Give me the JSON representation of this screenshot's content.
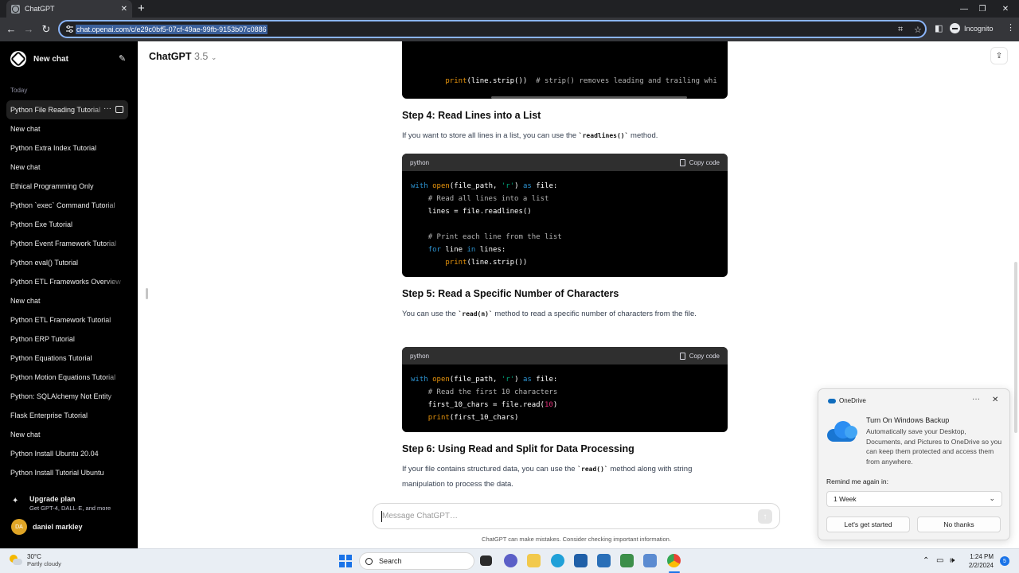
{
  "browser": {
    "tab_title": "ChatGPT",
    "url": "chat.openai.com/c/e29c0bf5-07cf-49ae-99fb-9153b07c0886",
    "profile_label": "Incognito"
  },
  "sidebar": {
    "new_chat_label": "New chat",
    "section_today": "Today",
    "chats": [
      {
        "label": "Python File Reading Tutorial",
        "active": true
      },
      {
        "label": "New chat"
      },
      {
        "label": "Python Extra Index Tutorial"
      },
      {
        "label": "New chat"
      },
      {
        "label": "Ethical Programming Only"
      },
      {
        "label": "Python `exec` Command Tutorial"
      },
      {
        "label": "Python Exe Tutorial"
      },
      {
        "label": "Python Event Framework Tutorial"
      },
      {
        "label": "Python eval() Tutorial"
      },
      {
        "label": "Python ETL Frameworks Overview"
      },
      {
        "label": "New chat"
      },
      {
        "label": "Python ETL Framework Tutorial"
      },
      {
        "label": "Python ERP Tutorial"
      },
      {
        "label": "Python Equations Tutorial"
      },
      {
        "label": "Python Motion Equations Tutorial"
      },
      {
        "label": "Python: SQLAlchemy Not Entity"
      },
      {
        "label": "Flask Enterprise Tutorial"
      },
      {
        "label": "New chat"
      },
      {
        "label": "Python Install Ubuntu 20.04"
      },
      {
        "label": "Python Install Tutorial Ubuntu"
      }
    ],
    "upgrade_title": "Upgrade plan",
    "upgrade_subtitle": "Get GPT-4, DALL·E, and more",
    "user_initials": "DA",
    "user_name": "daniel markley"
  },
  "main": {
    "model_name": "ChatGPT",
    "model_version": "3.5",
    "code_top_line": "print(line.strip())  # strip() removes leading and trailing whi",
    "step4": {
      "heading": "Step 4: Read Lines into a List",
      "text_before": "If you want to store all lines in a list, you can use the ",
      "inline": "`readlines()`",
      "text_after": " method.",
      "code_lang": "python",
      "copy_label": "Copy code"
    },
    "step5": {
      "heading": "Step 5: Read a Specific Number of Characters",
      "text_before": "You can use the ",
      "inline": "`read(n)`",
      "text_after": " method to read a specific number of characters from the file.",
      "code_lang": "python",
      "copy_label": "Copy code"
    },
    "step6": {
      "heading": "Step 6: Using Read and Split for Data Processing",
      "text_before": "If your file contains structured data, you can use the ",
      "inline": "`read()`",
      "text_after": " method along with string manipulation to process the data."
    },
    "composer_placeholder": "Message ChatGPT…",
    "disclaimer": "ChatGPT can make mistakes. Consider checking important information."
  },
  "toast": {
    "app_name": "OneDrive",
    "title": "Turn On Windows Backup",
    "body": "Automatically save your Desktop, Documents, and Pictures to OneDrive so you can keep them protected and access them from anywhere.",
    "remind_label": "Remind me again in:",
    "remind_value": "1 Week",
    "primary_button": "Let's get started",
    "secondary_button": "No thanks"
  },
  "taskbar": {
    "temperature": "30°C",
    "condition": "Partly cloudy",
    "search_label": "Search",
    "time": "1:24 PM",
    "date": "2/2/2024",
    "notification_count": "5"
  }
}
